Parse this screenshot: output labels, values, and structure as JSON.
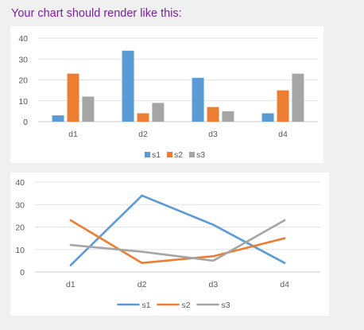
{
  "heading": "Your chart should render like this:",
  "chart_data": [
    {
      "type": "bar",
      "categories": [
        "d1",
        "d2",
        "d3",
        "d4"
      ],
      "series": [
        {
          "name": "s1",
          "values": [
            3,
            34,
            21,
            4
          ],
          "color": "#5b9bd5"
        },
        {
          "name": "s2",
          "values": [
            23,
            4,
            7,
            15
          ],
          "color": "#ed7d31"
        },
        {
          "name": "s3",
          "values": [
            12,
            9,
            5,
            23
          ],
          "color": "#a5a5a5"
        }
      ],
      "yticks": [
        "0",
        "10",
        "20",
        "30",
        "40"
      ],
      "ylim": [
        0,
        40
      ],
      "grid": true,
      "legend": "bottom"
    },
    {
      "type": "line",
      "categories": [
        "d1",
        "d2",
        "d3",
        "d4"
      ],
      "series": [
        {
          "name": "s1",
          "values": [
            3,
            34,
            21,
            4
          ],
          "color": "#5b9bd5"
        },
        {
          "name": "s2",
          "values": [
            23,
            4,
            7,
            15
          ],
          "color": "#ed7d31"
        },
        {
          "name": "s3",
          "values": [
            12,
            9,
            5,
            23
          ],
          "color": "#a5a5a5"
        }
      ],
      "yticks": [
        "0",
        "10",
        "20",
        "30",
        "40"
      ],
      "ylim": [
        0,
        40
      ],
      "grid": true,
      "legend": "bottom"
    }
  ]
}
